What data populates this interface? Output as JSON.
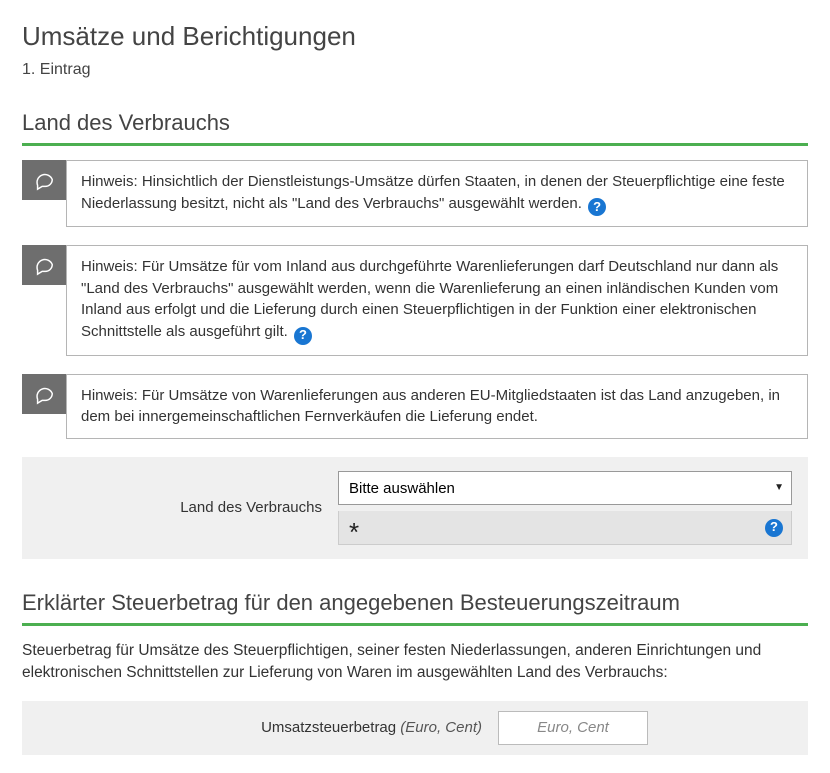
{
  "header": {
    "title": "Umsätze und Berichtigungen",
    "subtitle": "1. Eintrag"
  },
  "section_land": {
    "heading": "Land des Verbrauchs",
    "hints": [
      {
        "text": "Hinweis: Hinsichtlich der Dienstleistungs-Umsätze dürfen Staaten, in denen der Steuerpflichtige eine feste Niederlassung besitzt, nicht als \"Land des Verbrauchs\" ausgewählt werden.",
        "help": true
      },
      {
        "text": "Hinweis: Für Umsätze für vom Inland aus durchgeführte Warenlieferungen darf Deutschland nur dann als \"Land des Verbrauchs\" ausgewählt werden, wenn die Warenlieferung an einen inländischen Kunden vom Inland aus erfolgt und die Lieferung durch einen Steuerpflichtigen in der Funktion einer elektronischen Schnittstelle als ausgeführt gilt.",
        "help": true
      },
      {
        "text": "Hinweis: Für Umsätze von Warenlieferungen aus anderen EU-Mitgliedstaaten ist das Land anzugeben, in dem bei innergemeinschaftlichen Fernverkäufen die Lieferung endet.",
        "help": false
      }
    ],
    "select": {
      "label": "Land des Verbrauchs",
      "placeholder": "Bitte auswählen",
      "required_marker": "*",
      "help_symbol": "?"
    }
  },
  "section_tax": {
    "heading": "Erklärter Steuerbetrag für den angegebenen Besteuerungszeitraum",
    "description": "Steuerbetrag für Umsätze des Steuerpflichtigen, seiner festen Niederlassungen, anderen Einrichtungen und elektronischen Schnittstellen zur Lieferung von Waren im ausgewählten Land des Verbrauchs:",
    "amount": {
      "label": "Umsatzsteuerbetrag",
      "unit": "(Euro, Cent)",
      "placeholder": "Euro, Cent"
    }
  },
  "icons": {
    "help_symbol": "?"
  }
}
